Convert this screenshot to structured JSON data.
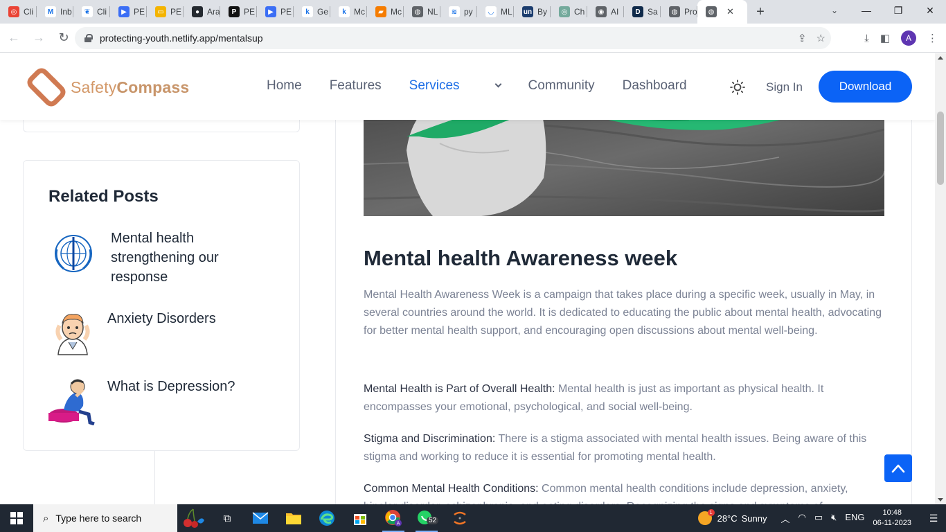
{
  "browser": {
    "tabs": [
      {
        "label": "Cli",
        "color": "#ea4335",
        "glyph": "◎"
      },
      {
        "label": "Inb",
        "color": "#ffffff",
        "glyph": "M"
      },
      {
        "label": "Cli",
        "color": "#ffffff",
        "glyph": "❦"
      },
      {
        "label": "PE",
        "color": "#3b6ef5",
        "glyph": "▶"
      },
      {
        "label": "PE",
        "color": "#f4b400",
        "glyph": "▭"
      },
      {
        "label": "Ara",
        "color": "#24292f",
        "glyph": "●"
      },
      {
        "label": "PE",
        "color": "#111111",
        "glyph": "P"
      },
      {
        "label": "PE",
        "color": "#3b6ef5",
        "glyph": "▶"
      },
      {
        "label": "Ge",
        "color": "#ffffff",
        "glyph": "k"
      },
      {
        "label": "Mc",
        "color": "#ffffff",
        "glyph": "k"
      },
      {
        "label": "Mc",
        "color": "#f57c00",
        "glyph": "▰"
      },
      {
        "label": "NL",
        "color": "#5f6368",
        "glyph": "◍"
      },
      {
        "label": "py",
        "color": "#ffffff",
        "glyph": "≋"
      },
      {
        "label": "ML",
        "color": "#ffffff",
        "glyph": "◡"
      },
      {
        "label": "By",
        "color": "#1c3d6e",
        "glyph": "un"
      },
      {
        "label": "Ch",
        "color": "#74aa9c",
        "glyph": "◎"
      },
      {
        "label": "AI",
        "color": "#5f6368",
        "glyph": "◉"
      },
      {
        "label": "Sa",
        "color": "#0f2a4a",
        "glyph": "D"
      },
      {
        "label": "Pro",
        "color": "#5f6368",
        "glyph": "◍"
      }
    ],
    "active_tab_close": "✕",
    "new_tab": "+",
    "tab_search": "⌄",
    "win_min": "—",
    "win_max": "❐",
    "win_close": "✕",
    "back": "←",
    "forward": "→",
    "reload": "↻",
    "url": "protecting-youth.netlify.app/mentalsup",
    "share": "⇪",
    "star": "☆",
    "download": "⤓",
    "sidepanel": "◧",
    "profile_initial": "A",
    "menu": "⋮"
  },
  "site": {
    "logo_prefix": "Safety",
    "logo_suffix": "Compass",
    "brand_color": "#d39868",
    "accent_color": "#0b63f6",
    "nav": {
      "home": "Home",
      "features": "Features",
      "services": "Services",
      "community": "Community",
      "dashboard": "Dashboard"
    },
    "signin": "Sign In",
    "download": "Download"
  },
  "sidebar": {
    "related_title": "Related Posts",
    "posts": [
      {
        "title": "Mental health strengthening our response",
        "thumb": "who-emblem"
      },
      {
        "title": "Anxiety Disorders",
        "thumb": "anxious-person"
      },
      {
        "title": "What is Depression?",
        "thumb": "sad-person"
      }
    ]
  },
  "article": {
    "title": "Mental health Awareness week",
    "intro": "Mental Health Awareness Week is a campaign that takes place during a specific week, usually in May, in several countries around the world. It is dedicated to educating the public about mental health, advocating for better mental health support, and encouraging open discussions about mental well-being.",
    "points": [
      {
        "label": "Mental Health is Part of Overall Health:",
        "text": " Mental health is just as important as physical health. It encompasses your emotional, psychological, and social well-being."
      },
      {
        "label": "Stigma and Discrimination:",
        "text": " There is a stigma associated with mental health issues. Being aware of this stigma and working to reduce it is essential for promoting mental health."
      },
      {
        "label": "Common Mental Health Conditions:",
        "text": " Common mental health conditions include depression, anxiety, bipolar disorder, schizophrenia, and eating disorders. Recognizing the signs and symptoms of"
      }
    ]
  },
  "taskbar": {
    "search_placeholder": "Type here to search",
    "whatsapp_badge": "52",
    "temperature": "28°C",
    "weather": "Sunny",
    "weather_alert": "1",
    "language": "ENG",
    "time": "10:48",
    "date": "06-11-2023"
  }
}
